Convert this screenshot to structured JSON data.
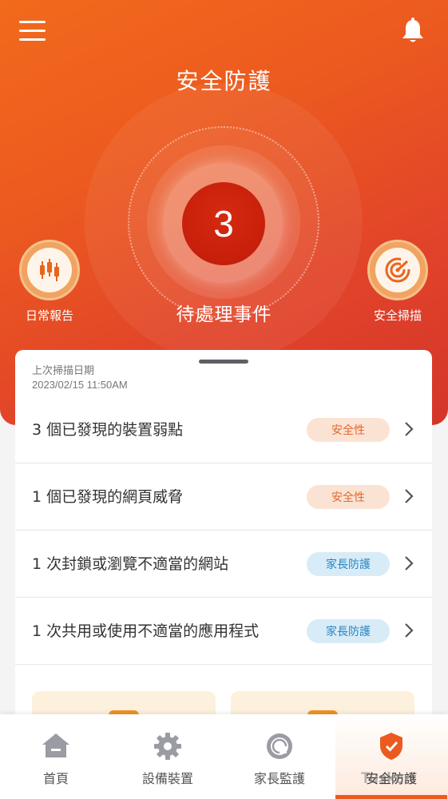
{
  "header": {
    "title": "安全防護",
    "menu_icon": "hamburger-icon",
    "notification_icon": "bell-icon"
  },
  "hero": {
    "pending_count": "3",
    "pending_label": "待處理事件",
    "left_action": {
      "label": "日常報告",
      "icon": "candlestick-report-icon"
    },
    "right_action": {
      "label": "安全掃描",
      "icon": "radar-scan-icon"
    }
  },
  "scan": {
    "label": "上次掃描日期",
    "date": "2023/02/15 11:50AM"
  },
  "events": [
    {
      "text": "3 個已發現的裝置弱點",
      "tag": "安全性",
      "tag_type": "security"
    },
    {
      "text": "1 個已發現的網頁威脅",
      "tag": "安全性",
      "tag_type": "security"
    },
    {
      "text": "1 次封鎖或瀏覽不適當的網站",
      "tag": "家長防護",
      "tag_type": "parental"
    },
    {
      "text": "1 次共用或使用不適當的應用程式",
      "tag": "家長防護",
      "tag_type": "parental"
    }
  ],
  "tabs": [
    {
      "label": "首頁",
      "icon": "home-icon",
      "active": false
    },
    {
      "label": "設備裝置",
      "icon": "gear-icon",
      "active": false
    },
    {
      "label": "家長監護",
      "icon": "parental-icon",
      "active": false
    },
    {
      "label": "安全防護",
      "icon": "shield-check-icon",
      "active": true
    }
  ],
  "colors": {
    "accent": "#ec5a1f",
    "security_tag_bg": "#fbe3d4",
    "security_tag_text": "#e4672c",
    "parental_tag_bg": "#d8ecf7",
    "parental_tag_text": "#2a86c2"
  },
  "watermark": "Tusker"
}
